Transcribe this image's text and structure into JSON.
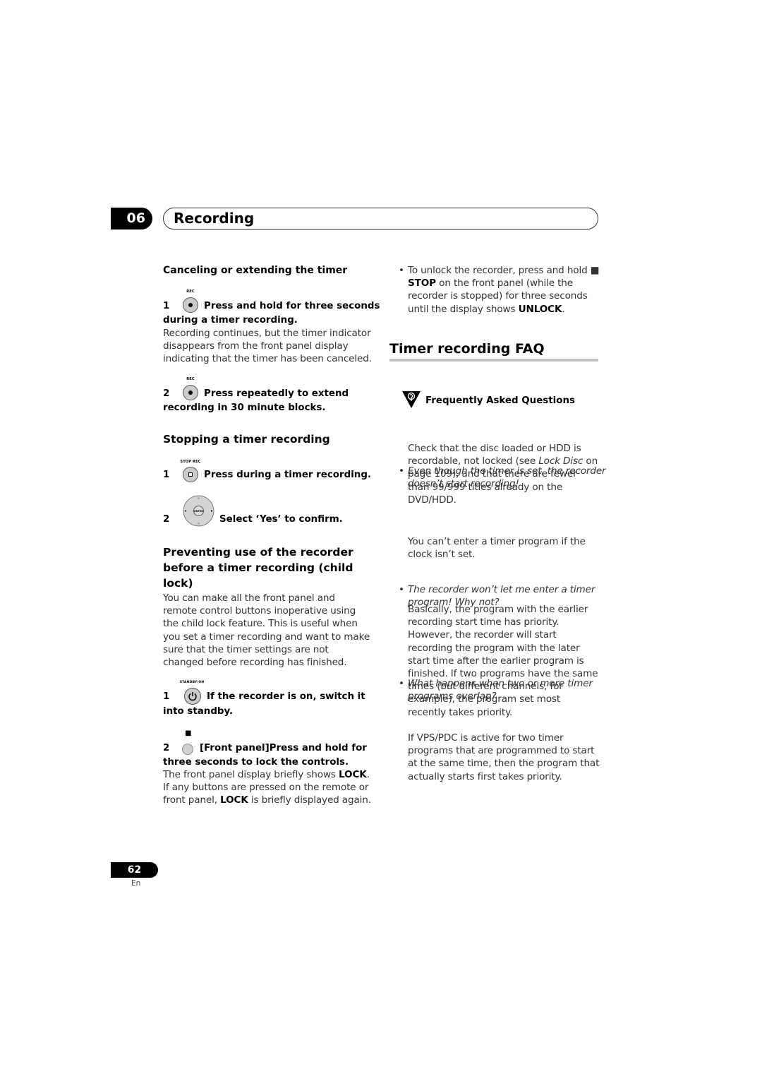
{
  "header": {
    "chapter_number": "06",
    "chapter_title": "Recording"
  },
  "left_column": {
    "cancel_section": {
      "heading": "Canceling or extending the timer",
      "step1": {
        "number": "1",
        "button_label": "REC",
        "icon": "rec-button-icon",
        "instruction_line1": "Press and hold for three seconds",
        "instruction_line2": "during a timer recording.",
        "body": "Recording continues, but the timer indicator disappears from the front panel display indicating that the timer has been canceled."
      },
      "step2": {
        "number": "2",
        "button_label": "REC",
        "icon": "rec-button-icon",
        "instruction_line1": "Press repeatedly to extend",
        "instruction_line2": "recording in 30 minute blocks."
      }
    },
    "stopping_section": {
      "heading": "Stopping a timer recording",
      "step1": {
        "number": "1",
        "button_label": "STOP REC",
        "icon": "stop-rec-button-icon",
        "instruction": "Press during a timer recording."
      },
      "step2": {
        "number": "2",
        "button_label": "ENTER",
        "icon": "directional-pad-enter-icon",
        "instruction": "Select ‘Yes’ to confirm."
      }
    },
    "child_lock_section": {
      "heading_line1": "Preventing use of the recorder",
      "heading_line2": "before a timer recording (child",
      "heading_line3": "lock)",
      "body": "You can make all the front panel and remote control buttons inoperative using the child lock feature. This is useful when you set a timer recording and want to make sure that the timer settings are not changed before recording has finished.",
      "step1": {
        "number": "1",
        "button_label": "STANDBY/ON",
        "icon": "power-button-icon",
        "instruction_line1": "If the recorder is on, switch it",
        "instruction_line2": "into standby."
      },
      "step2": {
        "number": "2",
        "button_label": "■",
        "icon": "front-panel-stop-button-icon",
        "instruction_line1": "[Front panel]Press and hold for",
        "instruction_line2": "three seconds to lock the controls.",
        "body_part1": "The front panel display briefly shows ",
        "body_bold1": "LOCK",
        "body_part2": ". If any buttons are pressed on the remote or front panel, ",
        "body_bold2": "LOCK",
        "body_part3": " is briefly displayed again."
      }
    }
  },
  "right_column": {
    "unlock_bullet": {
      "part1": "To unlock the recorder, press and hold ■ ",
      "bold1": "STOP",
      "part2": " on the front panel (while the recorder is stopped) for three seconds until the display shows ",
      "bold2": "UNLOCK",
      "part3": "."
    },
    "faq_title": "Timer recording FAQ",
    "faq_heading": "Frequently Asked Questions",
    "faq_icon": "question-mark-triangle-icon",
    "faq_items": [
      {
        "question": "Even though the timer is set, the recorder doesn’t start recording!",
        "answer_part1": "Check that the disc loaded or HDD is recordable, not locked (see ",
        "answer_italic": "Lock Disc",
        "answer_part2": " on page 109), and that there are fewer than 99/999 titles already on the DVD/HDD."
      },
      {
        "question": "The recorder won’t let me enter a timer program! Why not?",
        "answer": "You can’t enter a timer program if the clock isn’t set."
      },
      {
        "question": "What happens when two or more timer programs overlap?",
        "answer": "Basically, the program with the earlier recording start time has priority. However, the recorder will start recording the program with the later start time after the earlier program is finished. If two programs have the same times (but different channels, for example), the program set most recently takes priority.",
        "answer2": "If VPS/PDC is active for two timer programs that are programmed to start at the same time, then the program that actually starts first takes priority."
      }
    ]
  },
  "footer": {
    "page_number": "62",
    "language": "En"
  }
}
